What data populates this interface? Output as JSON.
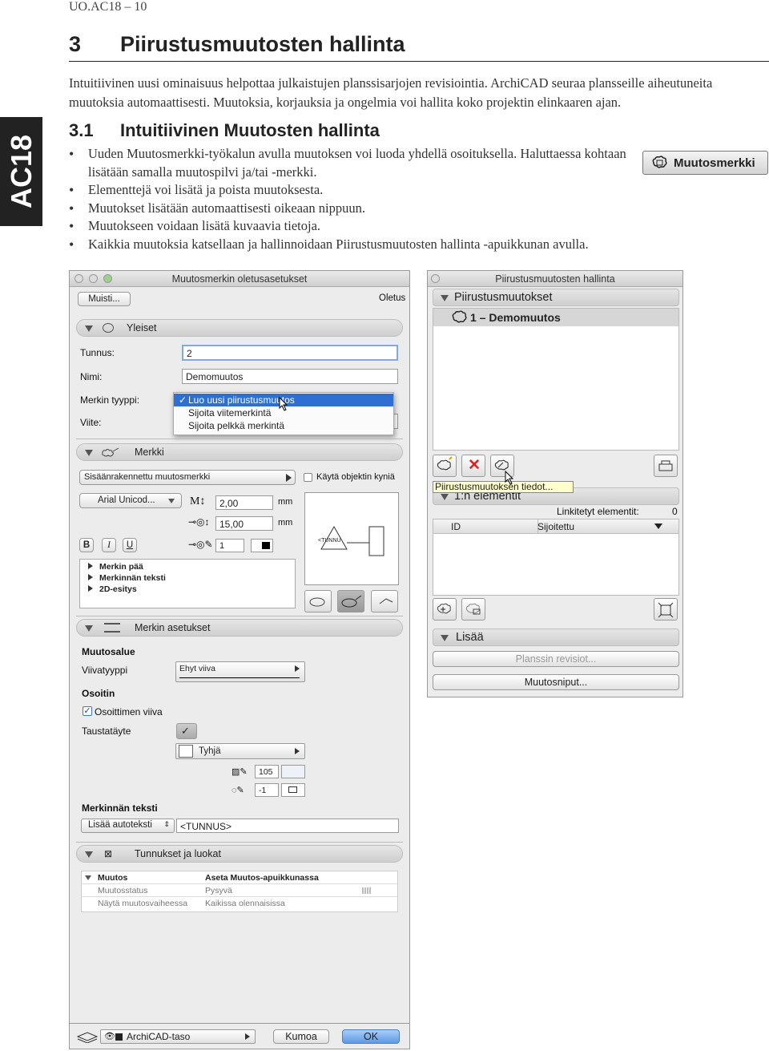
{
  "page": {
    "header": "UO.AC18 – 10",
    "chapter_number": "3",
    "chapter_title": "Piirustusmuutosten hallinta",
    "intro": "Intuitiivinen uusi ominaisuus helpottaa julkaistujen planssisarjojen revisiointia. ArchiCAD seuraa plansseille aiheutuneita muutoksia automaattisesti. Muutoksia, korjauksia ja ongelmia voi hallita koko projektin elinkaaren ajan.",
    "side_tab": "AC18",
    "section_number": "3.1",
    "section_title": "Intuitiivinen Muutosten hallinta",
    "bullets": [
      "Uuden Muutosmerkki-työkalun avulla muutoksen voi luoda yhdellä osoituksella. Haluttaessa kohtaan lisätään samalla muutospilvi ja/tai -merkki.",
      "Elementtejä voi lisätä ja poista muutoksesta.",
      "Muutokset lisätään automaattisesti oikeaan nippuun.",
      "Muutokseen voidaan lisätä kuvaavia tietoja.",
      "Kaikkia muutoksia katsellaan ja hallinnoidaan Piirustusmuutosten hallinta -apuikkunan avulla."
    ],
    "tool_button": "Muutosmerkki"
  },
  "dialog": {
    "title": "Muutosmerkin oletusasetukset",
    "favorites_button": "Muisti...",
    "default_label": "Oletus",
    "general_section": "Yleiset",
    "id_label": "Tunnus:",
    "id_value": "2",
    "name_label": "Nimi:",
    "name_value": "Demomuutos",
    "marker_type_label": "Merkin tyyppi:",
    "reference_label": "Viite:",
    "marker_type_options": [
      "Luo uusi piirustusmuutos",
      "Sijoita viitemerkintä",
      "Sijoita pelkkä merkintä"
    ],
    "marker_section": "Merkki",
    "marker_source": "Sisäänrakennettu muutosmerkki",
    "use_object_pens": "Käytä objektin kyniä",
    "font": "Arial Unicod...",
    "size1": "2,00",
    "size2": "15,00",
    "unit": "mm",
    "pen": "1",
    "fmt_bold": "B",
    "fmt_italic": "I",
    "fmt_underline": "U",
    "tree_items": [
      "Merkin pää",
      "Merkinnän teksti",
      "2D-esitys"
    ],
    "preview_text": "<TUNNU",
    "settings_section": "Merkin asetukset",
    "change_area": "Muutosalue",
    "line_type_label": "Viivatyyppi",
    "line_type_value": "Ehyt viiva",
    "pointer": "Osoitin",
    "pointer_line_label": "Osoittimen viiva",
    "background_fill": "Taustatäyte",
    "fill_value": "Tyhjä",
    "pen_value_1": "105",
    "pen_value_2": "-1",
    "marker_text": "Merkinnän teksti",
    "add_autotext": "Lisää autoteksti",
    "autotext_value": "<TUNNUS>",
    "ids_section": "Tunnukset ja luokat",
    "table": [
      {
        "col1": "Muutos",
        "col2": "Aseta Muutos-apuikkunassa",
        "bold": true
      },
      {
        "col1": "Muutosstatus",
        "col2": "Pysyvä",
        "bold": false
      },
      {
        "col1": "Näytä muutosvaiheessa",
        "col2": "Kaikissa olennaisissa",
        "bold": false
      }
    ],
    "layer": "ArchiCAD-taso",
    "cancel": "Kumoa",
    "ok": "OK"
  },
  "palette": {
    "title": "Piirustusmuutosten hallinta",
    "changes_section": "Piirustusmuutokset",
    "change_item": "1 – Demomuutos",
    "tooltip": "Piirustusmuutoksen tiedot...",
    "elements_section": "1:n elementit",
    "linked_label": "Linkitetyt elementit:",
    "linked_count": "0",
    "col_id": "ID",
    "col_placed": "Sijoitettu",
    "more_section": "Lisää",
    "sheet_revision": "Planssin revisiot...",
    "change_scheme": "Muutosniput..."
  },
  "colors": {
    "selection_blue": "#2f6fd1",
    "delete_red": "#d22"
  }
}
